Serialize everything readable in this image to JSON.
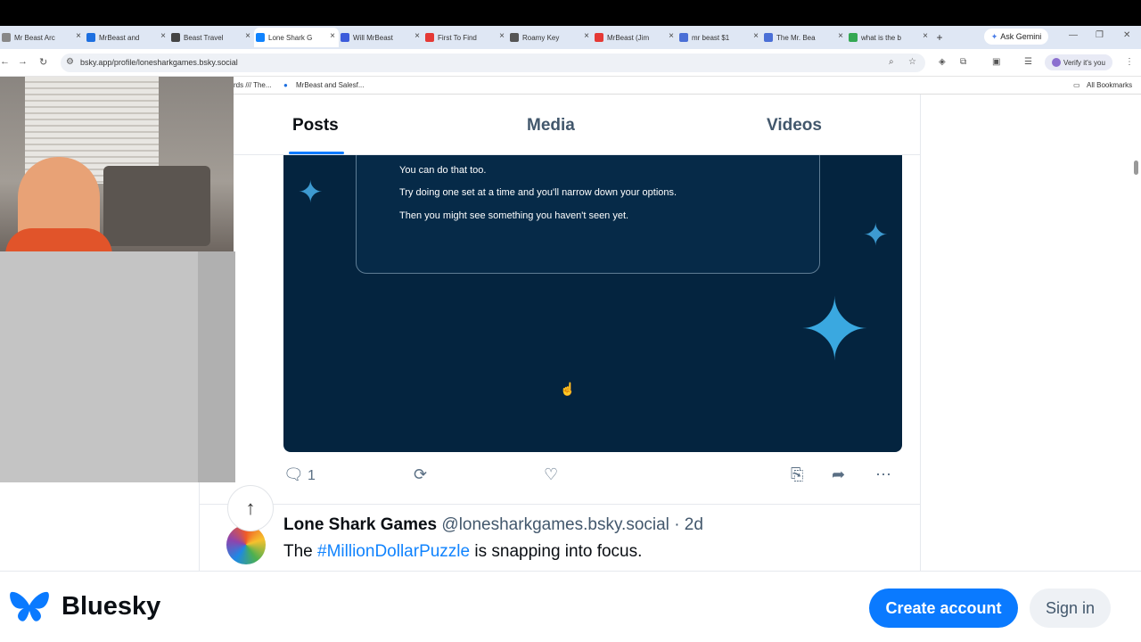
{
  "browser": {
    "tabs": [
      {
        "label": "Mr Beast Arc",
        "color": "#888"
      },
      {
        "label": "MrBeast and",
        "color": "#1d6fe0"
      },
      {
        "label": "Beast Travel",
        "color": "#444"
      },
      {
        "label": "Lone Shark G",
        "color": "#1083fe"
      },
      {
        "label": "Will MrBeast",
        "color": "#3b5bdb"
      },
      {
        "label": "First To Find",
        "color": "#e53935"
      },
      {
        "label": "Roamy Key",
        "color": "#555"
      },
      {
        "label": "MrBeast (Jim",
        "color": "#e53935"
      },
      {
        "label": "mr beast $1",
        "color": "#4a6fd6"
      },
      {
        "label": "The Mr. Bea",
        "color": "#4a6fd6"
      },
      {
        "label": "what is the b",
        "color": "#34a853"
      }
    ],
    "new_tab": "+",
    "gemini": "Ask Gemini",
    "url": "bsky.app/profile/lonesharkgames.bsky.social",
    "verify": "Verify it's you",
    "bookmarks": {
      "item1": "rds /// The...",
      "item2": "MrBeast and Salesf...",
      "all": "All Bookmarks"
    }
  },
  "profile_tabs": [
    "Posts",
    "Media",
    "Videos"
  ],
  "image_card_lines": [
    "You can do that too.",
    "Try doing one set at a time and you'll narrow down your options.",
    "Then you might see something you haven't seen yet."
  ],
  "post_actions": {
    "reply_count": "1"
  },
  "next_post": {
    "author": "Lone Shark Games",
    "handle": "@lonesharkgames.bsky.social",
    "age": "· 2d",
    "text_before": "The ",
    "hashtag": "#MillionDollarPuzzle",
    "text_after": " is snapping into focus."
  },
  "footer": {
    "brand": "Bluesky",
    "create": "Create account",
    "signin": "Sign in"
  },
  "colors": {
    "accent": "#0a7aff",
    "image_bg": "#04243f"
  }
}
